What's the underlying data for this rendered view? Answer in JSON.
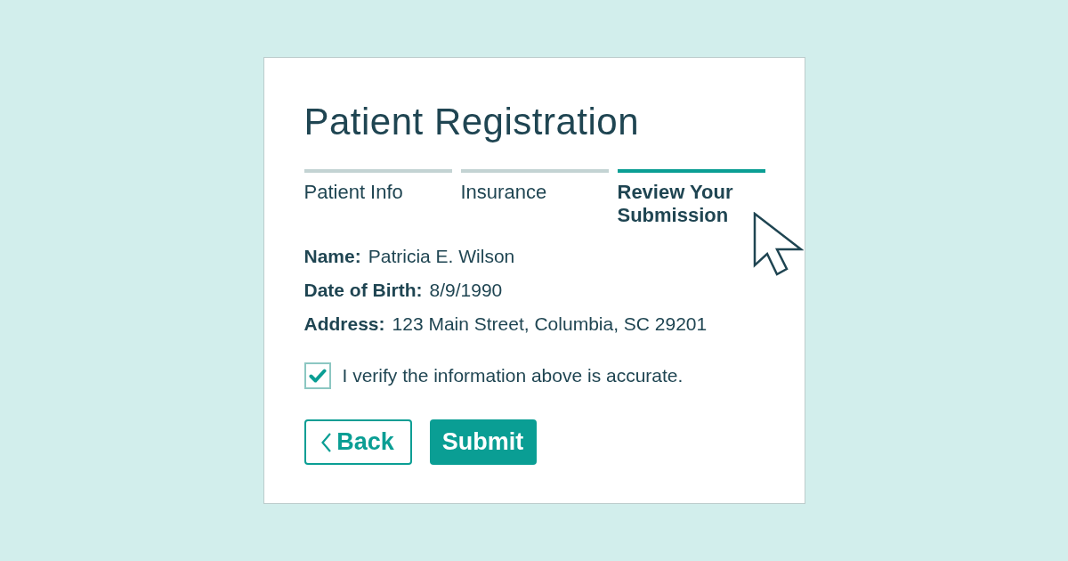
{
  "form": {
    "title": "Patient Registration",
    "steps": [
      {
        "label": "Patient Info",
        "selected": false
      },
      {
        "label": "Insurance",
        "selected": false
      },
      {
        "label": "Review Your Submission",
        "selected": true
      }
    ],
    "fields": [
      {
        "label": "Name:",
        "value": "Patricia E. Wilson"
      },
      {
        "label": "Date of Birth:",
        "value": "8/9/1990"
      },
      {
        "label": "Address:",
        "value": "123 Main Street, Columbia, SC 29201"
      }
    ],
    "verify": {
      "label": "I verify the information above is accurate.",
      "checked": true
    },
    "buttons": [
      {
        "label": "Back",
        "kind": "back"
      },
      {
        "label": "Submit",
        "kind": "submit"
      }
    ]
  }
}
